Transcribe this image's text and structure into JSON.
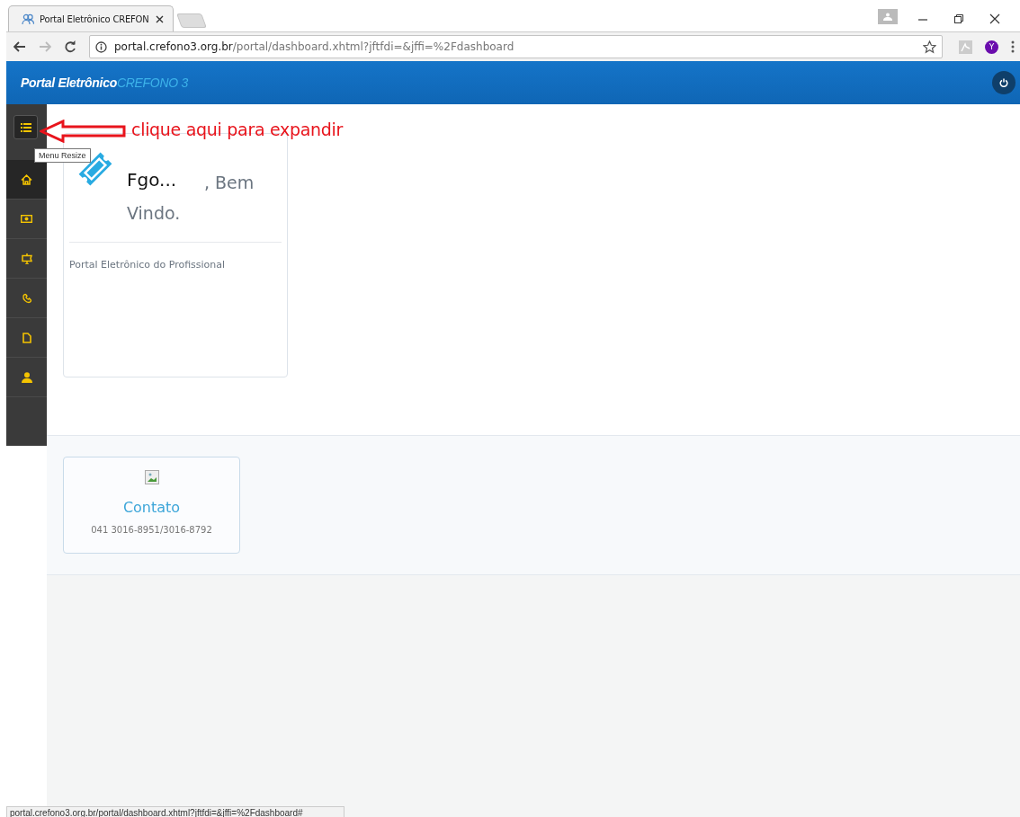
{
  "browser": {
    "tab": {
      "title": "Portal Eletrônico CREFON"
    },
    "address": {
      "host": "portal.crefono3.org.br",
      "path": "/portal/dashboard.xhtml?jftfdi=&jffi=%2Fdashboard"
    },
    "profile_initial": "Y"
  },
  "header": {
    "brand": "Portal Eletrônico",
    "brand_accent": "CREFONO 3"
  },
  "sidebar": {
    "toggle_tooltip": "Menu Resize",
    "items": [
      {
        "kind": "home",
        "selected": true
      },
      {
        "kind": "money",
        "selected": false
      },
      {
        "kind": "sign",
        "selected": false
      },
      {
        "kind": "phone",
        "selected": false
      },
      {
        "kind": "document",
        "selected": false
      },
      {
        "kind": "user",
        "selected": false
      }
    ]
  },
  "annotation": {
    "text": "clique aqui para expandir"
  },
  "welcome_card": {
    "name": "Fgo...",
    "greeting": ", Bem Vindo.",
    "subtitle": "Portal Eletrônico do Profissional"
  },
  "contact_card": {
    "title": "Contato",
    "phone": "041 3016-8951/3016-8792"
  },
  "status_bar": "portal.crefono3.org.br/portal/dashboard.xhtml?jftfdi=&jffi=%2Fdashboard#"
}
